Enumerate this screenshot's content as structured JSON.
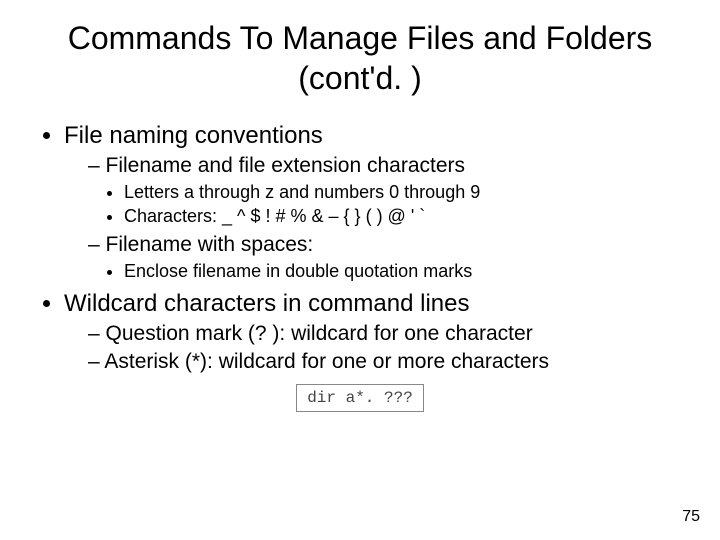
{
  "title": "Commands To Manage Files and Folders (cont'd. )",
  "bullets": {
    "b1": "File naming conventions",
    "b1a": "Filename and file extension characters",
    "b1a_i": "Letters a through z and numbers 0 through 9",
    "b1a_ii": "Characters: _ ^ $ ! # % & – { } ( ) @ ' `",
    "b1b": "Filename with spaces:",
    "b1b_i": "Enclose filename in double quotation marks",
    "b2": "Wildcard characters in command lines",
    "b2a": "Question mark (? ): wildcard for one character",
    "b2b": "Asterisk (*): wildcard for one or more characters"
  },
  "code_example": "dir a*. ???",
  "page_number": "75"
}
